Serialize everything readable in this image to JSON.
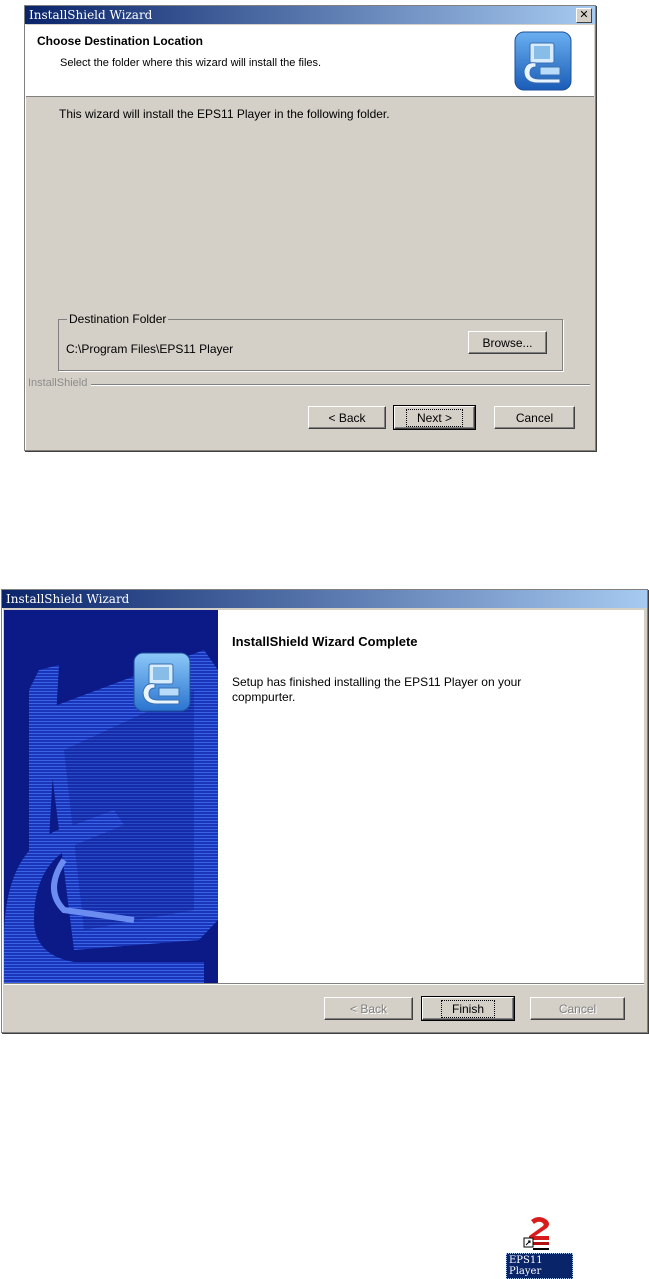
{
  "dialog1": {
    "title": "InstallShield Wizard",
    "close_glyph": "✕",
    "header_title": "Choose Destination Location",
    "header_subtitle": "Select the folder where this wizard will install the files.",
    "body_text": "This wizard will install the EPS11 Player in the following folder.",
    "group_label": "Destination Folder",
    "folder_path": "C:\\Program Files\\EPS11 Player",
    "browse_label": "Browse...",
    "brand_label": "InstallShield",
    "back_label": "< Back",
    "next_label": "Next >",
    "cancel_label": "Cancel"
  },
  "dialog2": {
    "title": "InstallShield Wizard",
    "heading": "InstallShield Wizard Complete",
    "message": "Setup has finished installing the EPS11 Player on your copmpurter.",
    "back_label": "< Back",
    "finish_label": "Finish",
    "cancel_label": "Cancel"
  },
  "desktop_icon": {
    "label": "EPS11 Player",
    "icon": "eps11-player-shortcut-icon"
  },
  "colors": {
    "title_gradient_start": "#0a246a",
    "title_gradient_end": "#a6caf0",
    "dialog_face": "#d4d0c8",
    "banner_blue": "#0b1a86",
    "icon_red": "#d81c1c"
  }
}
